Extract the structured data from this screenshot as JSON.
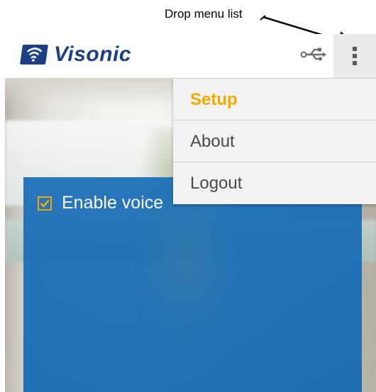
{
  "annotation": {
    "label": "Drop menu list"
  },
  "app": {
    "brand_name": "Visonic"
  },
  "colors": {
    "brand": "#1d3f85",
    "accent": "#f2a900",
    "panel": "#1a6db8",
    "menu_background": "#f2f2f2",
    "menu_text": "#4a4a4a"
  },
  "icons": {
    "brand": "wifi-signal-icon",
    "connection": "usb-icon",
    "overflow": "overflow-menu-icon",
    "checkbox": "checkbox-checked-icon"
  },
  "menu": {
    "items": [
      {
        "label": "Setup",
        "active": true
      },
      {
        "label": "About",
        "active": false
      },
      {
        "label": "Logout",
        "active": false
      }
    ]
  },
  "panel": {
    "enable_voice_label": "Enable voice",
    "enable_voice_checked": true
  }
}
